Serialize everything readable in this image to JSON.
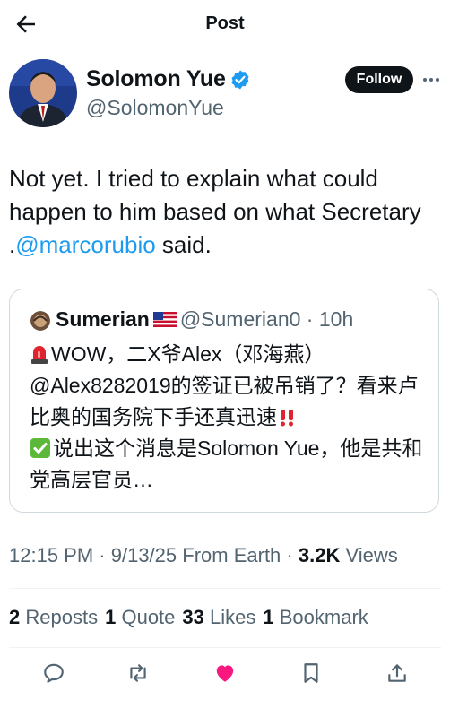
{
  "header": {
    "title": "Post"
  },
  "author": {
    "name": "Solomon Yue",
    "handle": "@SolomonYue",
    "follow_label": "Follow"
  },
  "tweet": {
    "text_part1": "Not yet. I tried to explain what could happen to him based on what Secretary .",
    "mention": "@marcorubio",
    "text_part2": " said."
  },
  "quote": {
    "name": "Sumerian",
    "handle": "@Sumerian0",
    "time": "10h",
    "line1": "WOW，二X爷Alex（邓海燕）@Alex8282019的签证已被吊销了？看来卢比奥的国务院下手还真迅速",
    "line2": "说出这个消息是Solomon Yue，他是共和党高层官员…"
  },
  "meta": {
    "time": "12:15 PM",
    "date": "9/13/25",
    "source": "From Earth",
    "views_count": "3.2K",
    "views_label": "Views"
  },
  "stats": {
    "reposts_count": "2",
    "reposts_label": "Reposts",
    "quotes_count": "1",
    "quotes_label": "Quote",
    "likes_count": "33",
    "likes_label": "Likes",
    "bookmarks_count": "1",
    "bookmarks_label": "Bookmark"
  },
  "icons": {
    "back": "arrow-left-icon",
    "verified": "verified-badge-icon",
    "more": "more-dots-icon",
    "flag": "us-flag-icon",
    "siren": "siren-emoji-icon",
    "bangbang": "double-exclamation-icon",
    "check": "check-mark-emoji-icon",
    "reply": "reply-icon",
    "repost": "repost-icon",
    "like": "heart-icon",
    "bookmark": "bookmark-icon",
    "share": "share-icon"
  },
  "colors": {
    "accent": "#1d9bf0",
    "like": "#f91880",
    "text": "#0f1419",
    "muted": "#536471"
  }
}
